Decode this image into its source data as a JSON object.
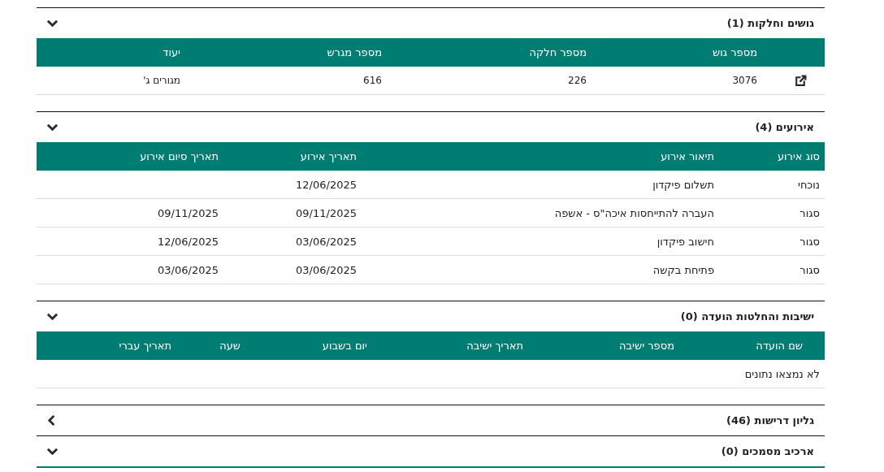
{
  "sections": [
    {
      "title": "גושים וחלקות (1)",
      "expanded": true,
      "columns": [
        "מספר גוש",
        "מספר חלקה",
        "מספר מגרש",
        "יעוד"
      ],
      "link_column": true,
      "rows": [
        {
          "cells": [
            "3076",
            "226",
            "616",
            "מגורים ג'"
          ]
        }
      ]
    },
    {
      "title": "אירועים (4)",
      "expanded": true,
      "columns": [
        "סוג אירוע",
        "תיאור אירוע",
        "תאריך אירוע",
        "תאריך סיום אירוע"
      ],
      "rows": [
        {
          "cells": [
            "נוכחי",
            "תשלום פיקדון",
            "12/06/2025",
            null
          ]
        },
        {
          "cells": [
            "סגור",
            "העברה להתייחסות איכה\"ס - אשפה",
            "09/11/2025",
            "09/11/2025"
          ]
        },
        {
          "cells": [
            "סגור",
            "חישוב פיקדון",
            "03/06/2025",
            "12/06/2025"
          ]
        },
        {
          "cells": [
            "סגור",
            "פתיחת בקשה",
            "03/06/2025",
            "03/06/2025"
          ]
        }
      ]
    },
    {
      "title": "ישיבות והחלטות הועדה (0)",
      "expanded": true,
      "columns": [
        "שם הועדה",
        "מספר ישיבה",
        "תאריך ישיבה",
        "יום בשבוע",
        "שעה",
        "תאריך עברי"
      ],
      "empty_message": "לא נמצאו נתונים"
    },
    {
      "title": "גליון דרישות (46)",
      "expanded": false
    },
    {
      "title": "ארכיב מסמכים (0)",
      "expanded": true
    }
  ]
}
